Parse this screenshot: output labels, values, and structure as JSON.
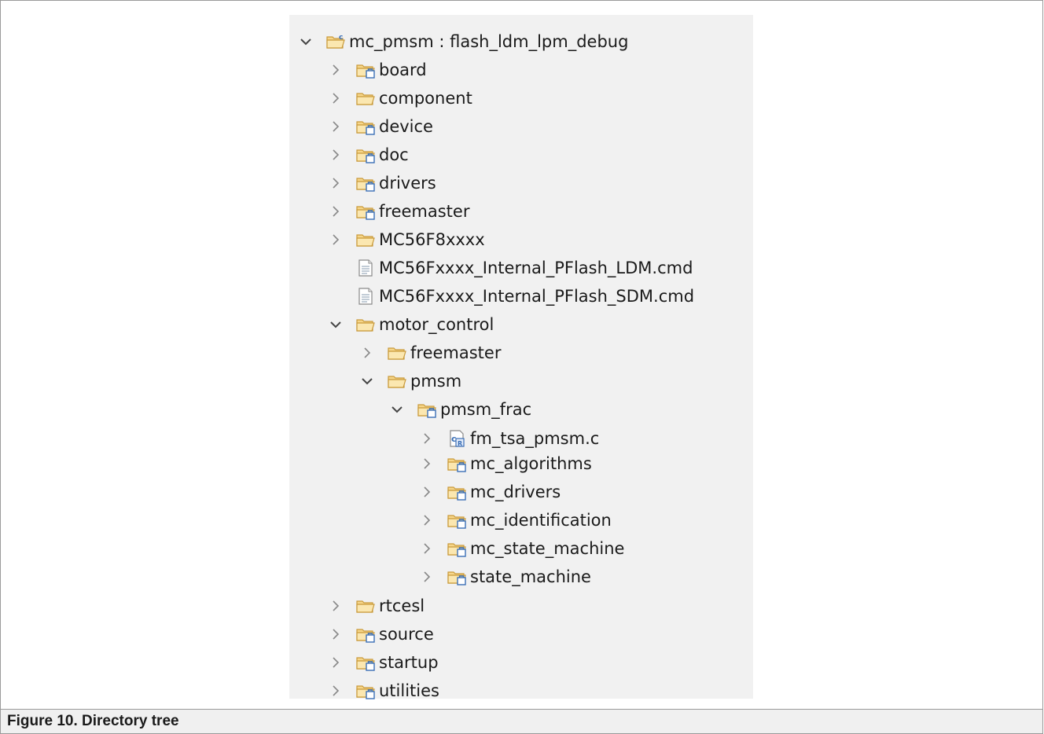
{
  "caption": "Figure 10.  Directory tree",
  "tree": [
    {
      "depth": 0,
      "label": "mc_pmsm : flash_ldm_lpm_debug",
      "icon": "c-project-icon",
      "expander": "expanded"
    },
    {
      "depth": 1,
      "label": "board",
      "icon": "source-folder-icon",
      "expander": "collapsed"
    },
    {
      "depth": 1,
      "label": "component",
      "icon": "folder-open-icon",
      "expander": "collapsed"
    },
    {
      "depth": 1,
      "label": "device",
      "icon": "source-folder-icon",
      "expander": "collapsed"
    },
    {
      "depth": 1,
      "label": "doc",
      "icon": "source-folder-icon",
      "expander": "collapsed"
    },
    {
      "depth": 1,
      "label": "drivers",
      "icon": "source-folder-icon",
      "expander": "collapsed"
    },
    {
      "depth": 1,
      "label": "freemaster",
      "icon": "source-folder-icon",
      "expander": "collapsed"
    },
    {
      "depth": 1,
      "label": "MC56F8xxxx",
      "icon": "folder-open-icon",
      "expander": "collapsed"
    },
    {
      "depth": 1,
      "label": "MC56Fxxxx_Internal_PFlash_LDM.cmd",
      "icon": "file-icon",
      "expander": "none"
    },
    {
      "depth": 1,
      "label": "MC56Fxxxx_Internal_PFlash_SDM.cmd",
      "icon": "file-icon",
      "expander": "none"
    },
    {
      "depth": 1,
      "label": "motor_control",
      "icon": "folder-open-icon",
      "expander": "expanded"
    },
    {
      "depth": 2,
      "label": "freemaster",
      "icon": "folder-open-icon",
      "expander": "collapsed"
    },
    {
      "depth": 2,
      "label": "pmsm",
      "icon": "folder-open-icon",
      "expander": "expanded"
    },
    {
      "depth": 3,
      "label": "pmsm_frac",
      "icon": "source-folder-icon",
      "expander": "expanded"
    },
    {
      "depth": 4,
      "label": "fm_tsa_pmsm.c",
      "icon": "c-file-icon",
      "expander": "collapsed"
    },
    {
      "depth": 4,
      "label": "mc_algorithms",
      "icon": "source-folder-icon",
      "expander": "collapsed"
    },
    {
      "depth": 4,
      "label": "mc_drivers",
      "icon": "source-folder-icon",
      "expander": "collapsed"
    },
    {
      "depth": 4,
      "label": "mc_identification",
      "icon": "source-folder-icon",
      "expander": "collapsed"
    },
    {
      "depth": 4,
      "label": "mc_state_machine",
      "icon": "source-folder-icon",
      "expander": "collapsed"
    },
    {
      "depth": 4,
      "label": "state_machine",
      "icon": "source-folder-icon",
      "expander": "collapsed"
    },
    {
      "depth": 1,
      "label": "rtcesl",
      "icon": "folder-open-icon",
      "expander": "collapsed"
    },
    {
      "depth": 1,
      "label": "source",
      "icon": "source-folder-icon",
      "expander": "collapsed"
    },
    {
      "depth": 1,
      "label": "startup",
      "icon": "source-folder-icon",
      "expander": "collapsed"
    },
    {
      "depth": 1,
      "label": "utilities",
      "icon": "source-folder-icon",
      "expander": "collapsed"
    }
  ],
  "colors": {
    "panel_bg": "#f1f1f1",
    "folder_fill": "#f6d68a",
    "folder_stroke": "#c99a3a",
    "source_badge": "#3b6fb6",
    "chevron": "#555555"
  }
}
